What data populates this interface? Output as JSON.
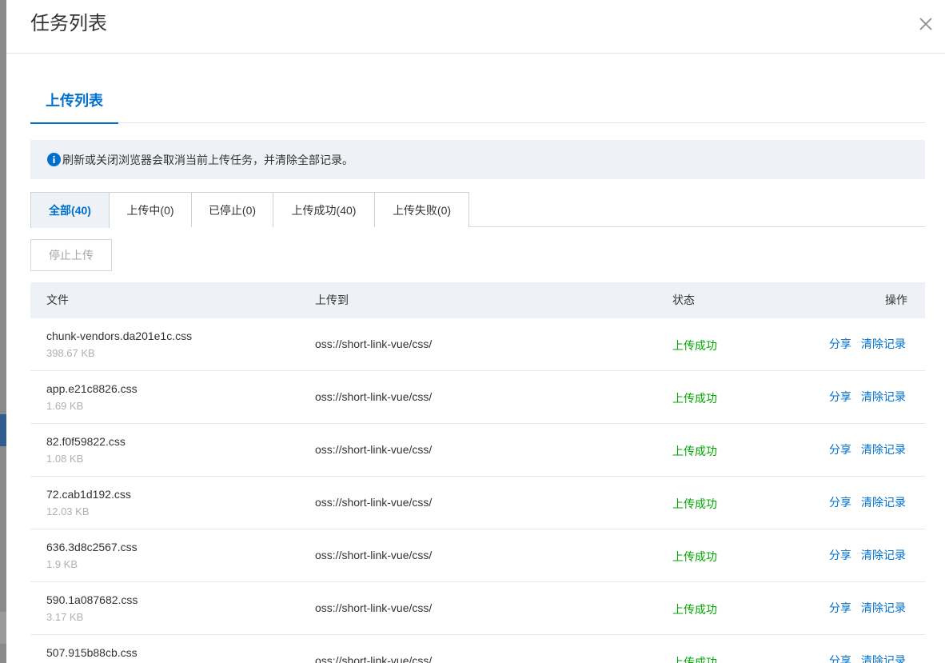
{
  "drawer": {
    "title": "任务列表",
    "close_icon": "close-icon"
  },
  "main_tab": {
    "label": "上传列表"
  },
  "notice": {
    "icon": "info-icon",
    "text": "刷新或关闭浏览器会取消当前上传任务，并清除全部记录。"
  },
  "filter_tabs": [
    {
      "label": "全部(40)",
      "active": true
    },
    {
      "label": "上传中(0)",
      "active": false
    },
    {
      "label": "已停止(0)",
      "active": false
    },
    {
      "label": "上传成功(40)",
      "active": false
    },
    {
      "label": "上传失败(0)",
      "active": false
    }
  ],
  "stop_button": {
    "label": "停止上传",
    "disabled": true
  },
  "table": {
    "headers": {
      "file": "文件",
      "upload_to": "上传到",
      "status": "状态",
      "actions": "操作"
    },
    "rows": [
      {
        "name": "chunk-vendors.da201e1c.css",
        "size": "398.67 KB",
        "dest": "oss://short-link-vue/css/",
        "status": "上传成功",
        "share": "分享",
        "clear": "清除记录"
      },
      {
        "name": "app.e21c8826.css",
        "size": "1.69 KB",
        "dest": "oss://short-link-vue/css/",
        "status": "上传成功",
        "share": "分享",
        "clear": "清除记录"
      },
      {
        "name": "82.f0f59822.css",
        "size": "1.08 KB",
        "dest": "oss://short-link-vue/css/",
        "status": "上传成功",
        "share": "分享",
        "clear": "清除记录"
      },
      {
        "name": "72.cab1d192.css",
        "size": "12.03 KB",
        "dest": "oss://short-link-vue/css/",
        "status": "上传成功",
        "share": "分享",
        "clear": "清除记录"
      },
      {
        "name": "636.3d8c2567.css",
        "size": "1.9 KB",
        "dest": "oss://short-link-vue/css/",
        "status": "上传成功",
        "share": "分享",
        "clear": "清除记录"
      },
      {
        "name": "590.1a087682.css",
        "size": "3.17 KB",
        "dest": "oss://short-link-vue/css/",
        "status": "上传成功",
        "share": "分享",
        "clear": "清除记录"
      },
      {
        "name": "507.915b88cb.css",
        "size": "",
        "dest": "oss://short-link-vue/css/",
        "status": "上传成功",
        "share": "分享",
        "clear": "清除记录"
      }
    ]
  },
  "colors": {
    "accent": "#0070cc",
    "success": "#00a700",
    "notice_bg": "#eef2f6",
    "muted_text": "#b0b0b0"
  }
}
